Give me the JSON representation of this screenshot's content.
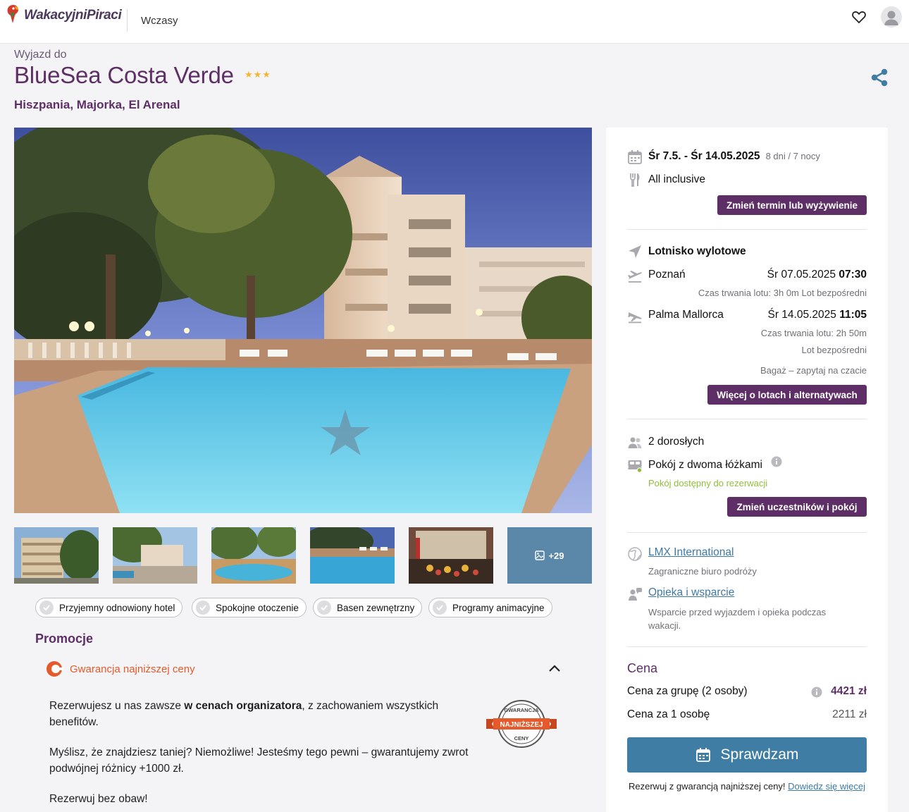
{
  "header": {
    "brand": "WakacyjniPiraci",
    "nav_label": "Wczasy"
  },
  "title": {
    "prefix": "Wyjazd do",
    "hotel_name": "BlueSea Costa Verde",
    "stars": "★★★",
    "star_count": 3,
    "location": "Hiszpania, Majorka, El Arenal"
  },
  "gallery": {
    "more_label": "+29"
  },
  "features": [
    {
      "label": "Przyjemny odnowiony hotel"
    },
    {
      "label": "Spokojne otoczenie"
    },
    {
      "label": "Basen zewnętrzny"
    },
    {
      "label": "Programy animacyjne"
    }
  ],
  "promo": {
    "heading": "Promocje",
    "guarantee_title": "Gwarancja najniższej ceny",
    "p1_a": "Rezerwujesz u nas zawsze ",
    "p1_b": "w cenach organizatora",
    "p1_c": ", z zachowaniem wszystkich benefitów.",
    "p2": "Myślisz, że znajdziesz taniej? Niemożliwe! Jesteśmy tego pewni – gwarantujemy zwrot podwójnej różnicy +1000 zł.",
    "p3": "Rezerwuj bez obaw!",
    "badge_top": "GWARANCJA",
    "badge_mid": "NAJNIŻSZEJ",
    "badge_bottom": "CENY"
  },
  "booking": {
    "dates": "Śr 7.5. - Śr 14.05.2025",
    "duration": "8 dni / 7 nocy",
    "board": "All inclusive",
    "change_term_btn": "Zmień termin lub wyżywienie",
    "airport_heading": "Lotnisko wylotowe",
    "outbound": {
      "city": "Poznań",
      "date": "Śr 07.05.2025",
      "time": "07:30",
      "info": "Czas trwania lotu: 3h 0m  Lot bezpośredni"
    },
    "return": {
      "city": "Palma Mallorca",
      "date": "Śr 14.05.2025",
      "time": "11:05",
      "duration": "Czas trwania lotu: 2h 50m",
      "direct": "Lot bezpośredni"
    },
    "baggage": "Bagaż – zapytaj na czacie",
    "flights_btn": "Więcej o lotach i alternatywach",
    "adults": "2 dorosłych",
    "room": "Pokój z dwoma łóżkami",
    "room_status": "Pokój dostępny do rezerwacji",
    "change_people_btn": "Zmień uczestników i pokój",
    "organizer_link": "LMX International",
    "organizer_desc": "Zagraniczne biuro podróży",
    "support_link": "Opieka i wsparcie",
    "support_desc": "Wsparcie przed wyjazdem i opieka podczas wakacji.",
    "price_heading": "Cena",
    "group_label": "Cena za grupę (2 osoby)",
    "group_price": "4421 zł",
    "per_person_label": "Cena za 1 osobę",
    "per_person_price": "2211 zł",
    "cta": "Sprawdzam",
    "footer_text": "Rezerwuj z gwarancją najniższej ceny! ",
    "footer_link": "Dowiedz się więcej"
  },
  "colors": {
    "brand_purple": "#5e2f66",
    "cta_blue": "#3f7da4",
    "link_blue": "#3e79a8",
    "available_green": "#8fbf3a",
    "guarantee_orange": "#e55a2b",
    "star_gold": "#f3b632"
  }
}
